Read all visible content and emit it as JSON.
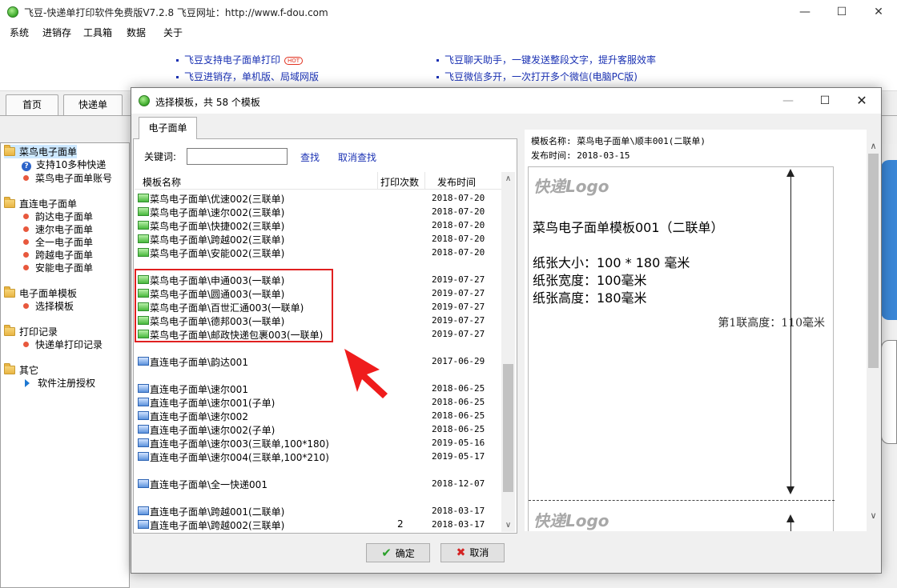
{
  "app": {
    "title": "飞豆-快递单打印软件免费版V7.2.8  飞豆网址：http://www.f-dou.com",
    "menu": [
      "系统",
      "进销存",
      "工具箱",
      "数据",
      "关于"
    ]
  },
  "banner": {
    "left": [
      "飞豆支持电子面单打印",
      "飞豆进销存，单机版、局域网版"
    ],
    "right": [
      "飞豆聊天助手，一键发送整段文字，提升客服效率",
      "飞豆微信多开，一次打开多个微信(电脑PC版)"
    ],
    "hot": "HOT"
  },
  "main_tabs": [
    "首页",
    "快递单"
  ],
  "sidebar": {
    "groups": [
      {
        "label": "菜鸟电子面单",
        "items": [
          {
            "label": "支持10多种快递",
            "icon": "help-icon"
          },
          {
            "label": "菜鸟电子面单账号",
            "icon": "dot-icon"
          }
        ]
      },
      {
        "label": "直连电子面单",
        "items": [
          {
            "label": "韵达电子面单",
            "icon": "dot-icon"
          },
          {
            "label": "速尔电子面单",
            "icon": "dot-icon"
          },
          {
            "label": "全一电子面单",
            "icon": "dot-icon"
          },
          {
            "label": "跨越电子面单",
            "icon": "dot-icon"
          },
          {
            "label": "安能电子面单",
            "icon": "dot-icon"
          }
        ]
      },
      {
        "label": "电子面单模板",
        "items": [
          {
            "label": "选择模板",
            "icon": "dot-icon"
          }
        ]
      },
      {
        "label": "打印记录",
        "items": [
          {
            "label": "快递单打印记录",
            "icon": "dot-icon"
          }
        ]
      },
      {
        "label": "其它",
        "items": [
          {
            "label": "软件注册授权",
            "icon": "play-icon"
          }
        ]
      }
    ]
  },
  "dialog": {
    "title": "选择模板，共 58 个模板",
    "tab": "电子面单",
    "keyword_label": "关键词:",
    "keyword_value": "",
    "search": "查找",
    "cancel_search": "取消查找",
    "columns": [
      "模板名称",
      "打印次数",
      "发布时间"
    ],
    "rows": [
      {
        "name": "菜鸟电子面单\\优速002(三联单)",
        "count": "",
        "date": "2018-07-20",
        "color": "green"
      },
      {
        "name": "菜鸟电子面单\\速尔002(三联单)",
        "count": "",
        "date": "2018-07-20",
        "color": "green"
      },
      {
        "name": "菜鸟电子面单\\快捷002(三联单)",
        "count": "",
        "date": "2018-07-20",
        "color": "green"
      },
      {
        "name": "菜鸟电子面单\\跨越002(三联单)",
        "count": "",
        "date": "2018-07-20",
        "color": "green"
      },
      {
        "name": "菜鸟电子面单\\安能002(三联单)",
        "count": "",
        "date": "2018-07-20",
        "color": "green"
      },
      null,
      {
        "name": "菜鸟电子面单\\申通003(一联单)",
        "count": "",
        "date": "2019-07-27",
        "color": "green"
      },
      {
        "name": "菜鸟电子面单\\圆通003(一联单)",
        "count": "",
        "date": "2019-07-27",
        "color": "green"
      },
      {
        "name": "菜鸟电子面单\\百世汇通003(一联单)",
        "count": "",
        "date": "2019-07-27",
        "color": "green"
      },
      {
        "name": "菜鸟电子面单\\德邦003(一联单)",
        "count": "",
        "date": "2019-07-27",
        "color": "green"
      },
      {
        "name": "菜鸟电子面单\\邮政快递包裹003(一联单)",
        "count": "",
        "date": "2019-07-27",
        "color": "green"
      },
      null,
      {
        "name": "直连电子面单\\韵达001",
        "count": "",
        "date": "2017-06-29",
        "color": "blue"
      },
      null,
      {
        "name": "直连电子面单\\速尔001",
        "count": "",
        "date": "2018-06-25",
        "color": "blue"
      },
      {
        "name": "直连电子面单\\速尔001(子单)",
        "count": "",
        "date": "2018-06-25",
        "color": "blue"
      },
      {
        "name": "直连电子面单\\速尔002",
        "count": "",
        "date": "2018-06-25",
        "color": "blue"
      },
      {
        "name": "直连电子面单\\速尔002(子单)",
        "count": "",
        "date": "2018-06-25",
        "color": "blue"
      },
      {
        "name": "直连电子面单\\速尔003(三联单,100*180)",
        "count": "",
        "date": "2019-05-16",
        "color": "blue"
      },
      {
        "name": "直连电子面单\\速尔004(三联单,100*210)",
        "count": "",
        "date": "2019-05-17",
        "color": "blue"
      },
      null,
      {
        "name": "直连电子面单\\全一快递001",
        "count": "",
        "date": "2018-12-07",
        "color": "blue"
      },
      null,
      {
        "name": "直连电子面单\\跨越001(二联单)",
        "count": "",
        "date": "2018-03-17",
        "color": "blue"
      },
      {
        "name": "直连电子面单\\跨越002(三联单)",
        "count": "2",
        "date": "2018-03-17",
        "color": "blue"
      }
    ],
    "preview": {
      "name_line": "模板名称: 菜鸟电子面单\\顺丰001(二联单)",
      "date_line": "发布时间: 2018-03-15",
      "logo": "快递Logo",
      "template_title": "菜鸟电子面单模板001（二联单）",
      "paper_size": "纸张大小：100 * 180 毫米",
      "paper_width": "纸张宽度：100毫米",
      "paper_height": "纸张高度：180毫米",
      "part_height": "第1联高度：110毫米",
      "logo2": "快递Logo"
    },
    "ok": "确定",
    "cancel": "取消"
  },
  "colors": {
    "link": "#1a31b3",
    "highlight": "#e02020",
    "arrow": "#ef1c1c"
  }
}
